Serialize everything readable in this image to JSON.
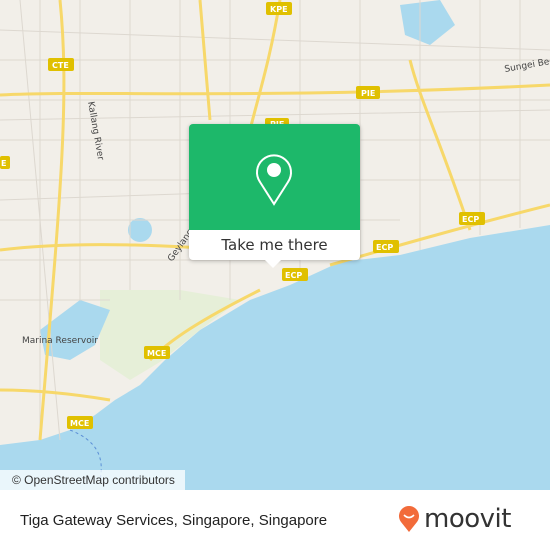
{
  "map": {
    "colors": {
      "land": "#f2efe9",
      "sea": "#aad9ee",
      "park": "#c8e6b0",
      "highway": "#f7d86a",
      "shield": "#e0c000"
    },
    "road_shields": [
      "KPE",
      "CTE",
      "PIE",
      "PIE",
      "ECP",
      "ECP",
      "ECP",
      "MCE",
      "MCE",
      "E"
    ],
    "labels": {
      "geylang": "Geylang",
      "marina": "Marina Reservoir",
      "kallang": "Kallang River",
      "sungei": "Sungei Bedok"
    },
    "attribution": "© OpenStreetMap contributors"
  },
  "popup": {
    "icon": "map-pin-icon",
    "action_label": "Take me there",
    "color": "#1db86a"
  },
  "footer": {
    "place_name": "Tiga Gateway Services, Singapore, Singapore",
    "brand": "moovit",
    "brand_color": "#f26b3a"
  }
}
